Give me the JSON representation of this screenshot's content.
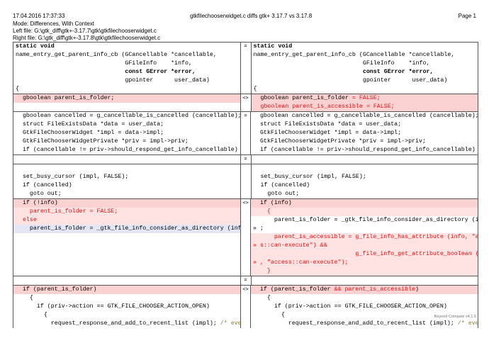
{
  "header": {
    "datetime": "17.04.2016 17:37:33",
    "title": "gtkfilechooserwidget.c diffs gtk+ 3.17.7  vs 3.17.8",
    "page": "Page 1",
    "mode": "Mode:  Differences, With Context",
    "left_file": "Left file: G:\\gtk_diff\\gtk+-3.17.7\\gtk\\gtkfilechooserwidget.c",
    "right_file": "Right file: G:\\gtk_diff\\gtk+-3.17.8\\gtk\\gtkfilechooserwidget.c"
  },
  "footer": "Beyond Compare v4.1.5",
  "markers": {
    "equal": "=",
    "diff": "<>"
  },
  "blocks": {
    "b1_left": [
      "static void",
      "name_entry_get_parent_info_cb (GCancellable *cancellable,",
      "                               GFileInfo    *info,",
      "                               const GError *error,",
      "                               gpointer      user_data)",
      "{"
    ],
    "b1_right": [
      "static void",
      "name_entry_get_parent_info_cb (GCancellable *cancellable,",
      "                               GFileInfo    *info,",
      "                               const GError *error,",
      "                               gpointer      user_data)",
      "{"
    ],
    "b2_left": [
      "  gboolean parent_is_folder;"
    ],
    "b2_right_1": "  gboolean parent_is_folder",
    "b2_right_1_red": " = FALSE;",
    "b2_right_2": "  gboolean parent_is_accessible = FALSE;",
    "b3_left": [
      "  gboolean cancelled = g_cancellable_is_cancelled (cancellable);",
      "  struct FileExistsData *data = user_data;",
      "  GtkFileChooserWidget *impl = data->impl;",
      "  GtkFileChooserWidgetPrivate *priv = impl->priv;",
      "  if (cancellable != priv->should_respond_get_info_cancellable)"
    ],
    "b3_right": [
      "  gboolean cancelled = g_cancellable_is_cancelled (cancellable);",
      "  struct FileExistsData *data = user_data;",
      "  GtkFileChooserWidget *impl = data->impl;",
      "  GtkFileChooserWidgetPrivate *priv = impl->priv;",
      "  if (cancellable != priv->should_respond_get_info_cancellable)"
    ],
    "b4_left": [
      "  set_busy_cursor (impl, FALSE);",
      "  if (cancelled)",
      "    goto out;"
    ],
    "b4_right": [
      "  set_busy_cursor (impl, FALSE);",
      "  if (cancelled)",
      "    goto out;"
    ],
    "b5_left": [
      "  if (!info)",
      "    parent_is_folder = FALSE;",
      "  else",
      "    parent_is_folder = _gtk_file_info_consider_as_directory (info);"
    ],
    "b5_right": [
      "  if (info)",
      "    {",
      "      parent_is_folder = _gtk_file_info_consider_as_directory (info)",
      "» ;",
      "      parent_is_accessible = g_file_info_has_attribute (info, \"acces",
      "» s::can-execute\") &&",
      "                             g_file_info_get_attribute_boolean (info",
      "» , \"access::can-execute\");",
      "    }"
    ],
    "b6_left": [
      "  if (parent_is_folder)",
      "    {",
      "      if (priv->action == GTK_FILE_CHOOSER_ACTION_OPEN)",
      "        {",
      "          request_response_and_add_to_recent_list (impl); "
    ],
    "b6_right_1": "  if (parent_is_folder",
    "b6_right_1_red": " && parent_is_accessible",
    "b6_right_1_end": ")",
    "b6_right": [
      "    {",
      "      if (priv->action == GTK_FILE_CHOOSER_ACTION_OPEN)",
      "        {",
      "          request_response_and_add_to_recent_list (impl); "
    ],
    "comment": "/* even if"
  }
}
